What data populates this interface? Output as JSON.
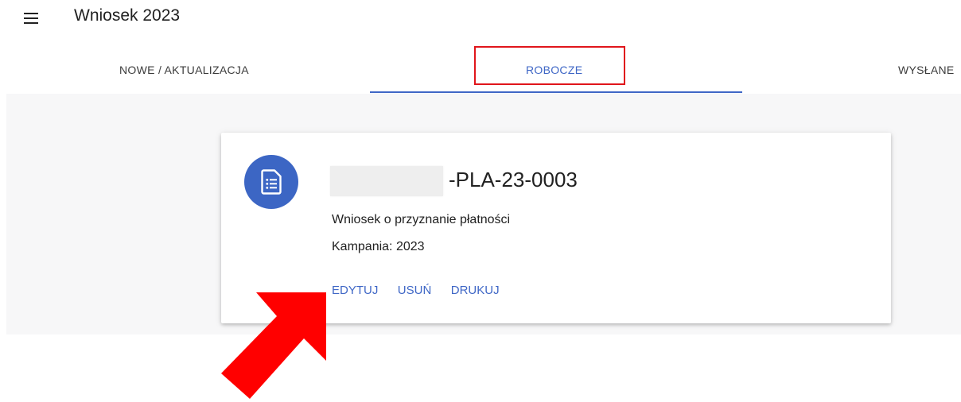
{
  "app": {
    "title": "Wniosek 2023"
  },
  "tabs": [
    {
      "label": "NOWE / AKTUALIZACJA",
      "active": false
    },
    {
      "label": "ROBOCZE",
      "active": true
    },
    {
      "label": "WYSŁANE",
      "active": false
    }
  ],
  "card": {
    "icon": "document-list-icon",
    "id_suffix": "-PLA-23-0003",
    "type": "Wniosek o przyznanie płatności",
    "campaign": "Kampania: 2023",
    "actions": {
      "edit": "EDYTUJ",
      "delete": "USUŃ",
      "print": "DRUKUJ"
    }
  },
  "annotations": {
    "arrow_icon": "red-arrow-icon",
    "highlight_color": "#e0151b"
  },
  "colors": {
    "accent": "#3f67c6",
    "avatar": "#3c66c4",
    "annotation": "#e0151b"
  }
}
